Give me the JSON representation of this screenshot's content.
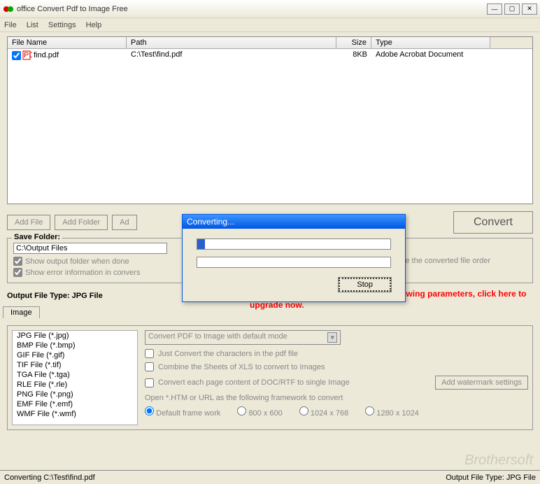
{
  "window": {
    "title": "office Convert Pdf to Image Free"
  },
  "menu": {
    "file": "File",
    "list": "List",
    "settings": "Settings",
    "help": "Help"
  },
  "table": {
    "headers": {
      "name": "File Name",
      "path": "Path",
      "size": "Size",
      "type": "Type"
    },
    "rows": [
      {
        "name": "find.pdf",
        "path": "C:\\Test\\find.pdf",
        "size": "8KB",
        "type": "Adobe Acrobat Document"
      }
    ]
  },
  "toolbar": {
    "add_file": "Add File",
    "add_folder": "Add Folder",
    "add_url": "Ad",
    "convert": "Convert"
  },
  "save_folder": {
    "label": "Save Folder:",
    "value": "C:\\Output Files",
    "show_output": "Show output folder when done",
    "show_error": "Show error information in convers",
    "include_order": "Include the converted file order"
  },
  "output": {
    "label": "Output File Type:  JPG File",
    "upgrade": "The registered version can set the following parameters, click here to upgrade now.",
    "tab": "Image",
    "formats": [
      "JPG File  (*.jpg)",
      "BMP File  (*.bmp)",
      "GIF File  (*.gif)",
      "TIF File  (*.tif)",
      "TGA File  (*.tga)",
      "RLE File  (*.rle)",
      "PNG File  (*.png)",
      "EMF File  (*.emf)",
      "WMF File  (*.wmf)"
    ],
    "mode": "Convert PDF to Image with default mode",
    "opt1": "Just Convert the characters in the pdf file",
    "opt2": "Combine the Sheets of XLS to convert to Images",
    "opt3": "Convert each page content of DOC/RTF to single Image",
    "watermark": "Add watermark settings",
    "htm_note": "Open *.HTM or URL as the following framework to convert",
    "radios": {
      "r1": "Default frame work",
      "r2": "800 x 600",
      "r3": "1024 x 768",
      "r4": "1280 x 1024"
    }
  },
  "dialog": {
    "title": "Converting...",
    "stop": "Stop"
  },
  "status": {
    "left": "Converting  C:\\Test\\find.pdf",
    "right": "Output File Type:  JPG File"
  },
  "watermark_logo": "Brothersoft"
}
